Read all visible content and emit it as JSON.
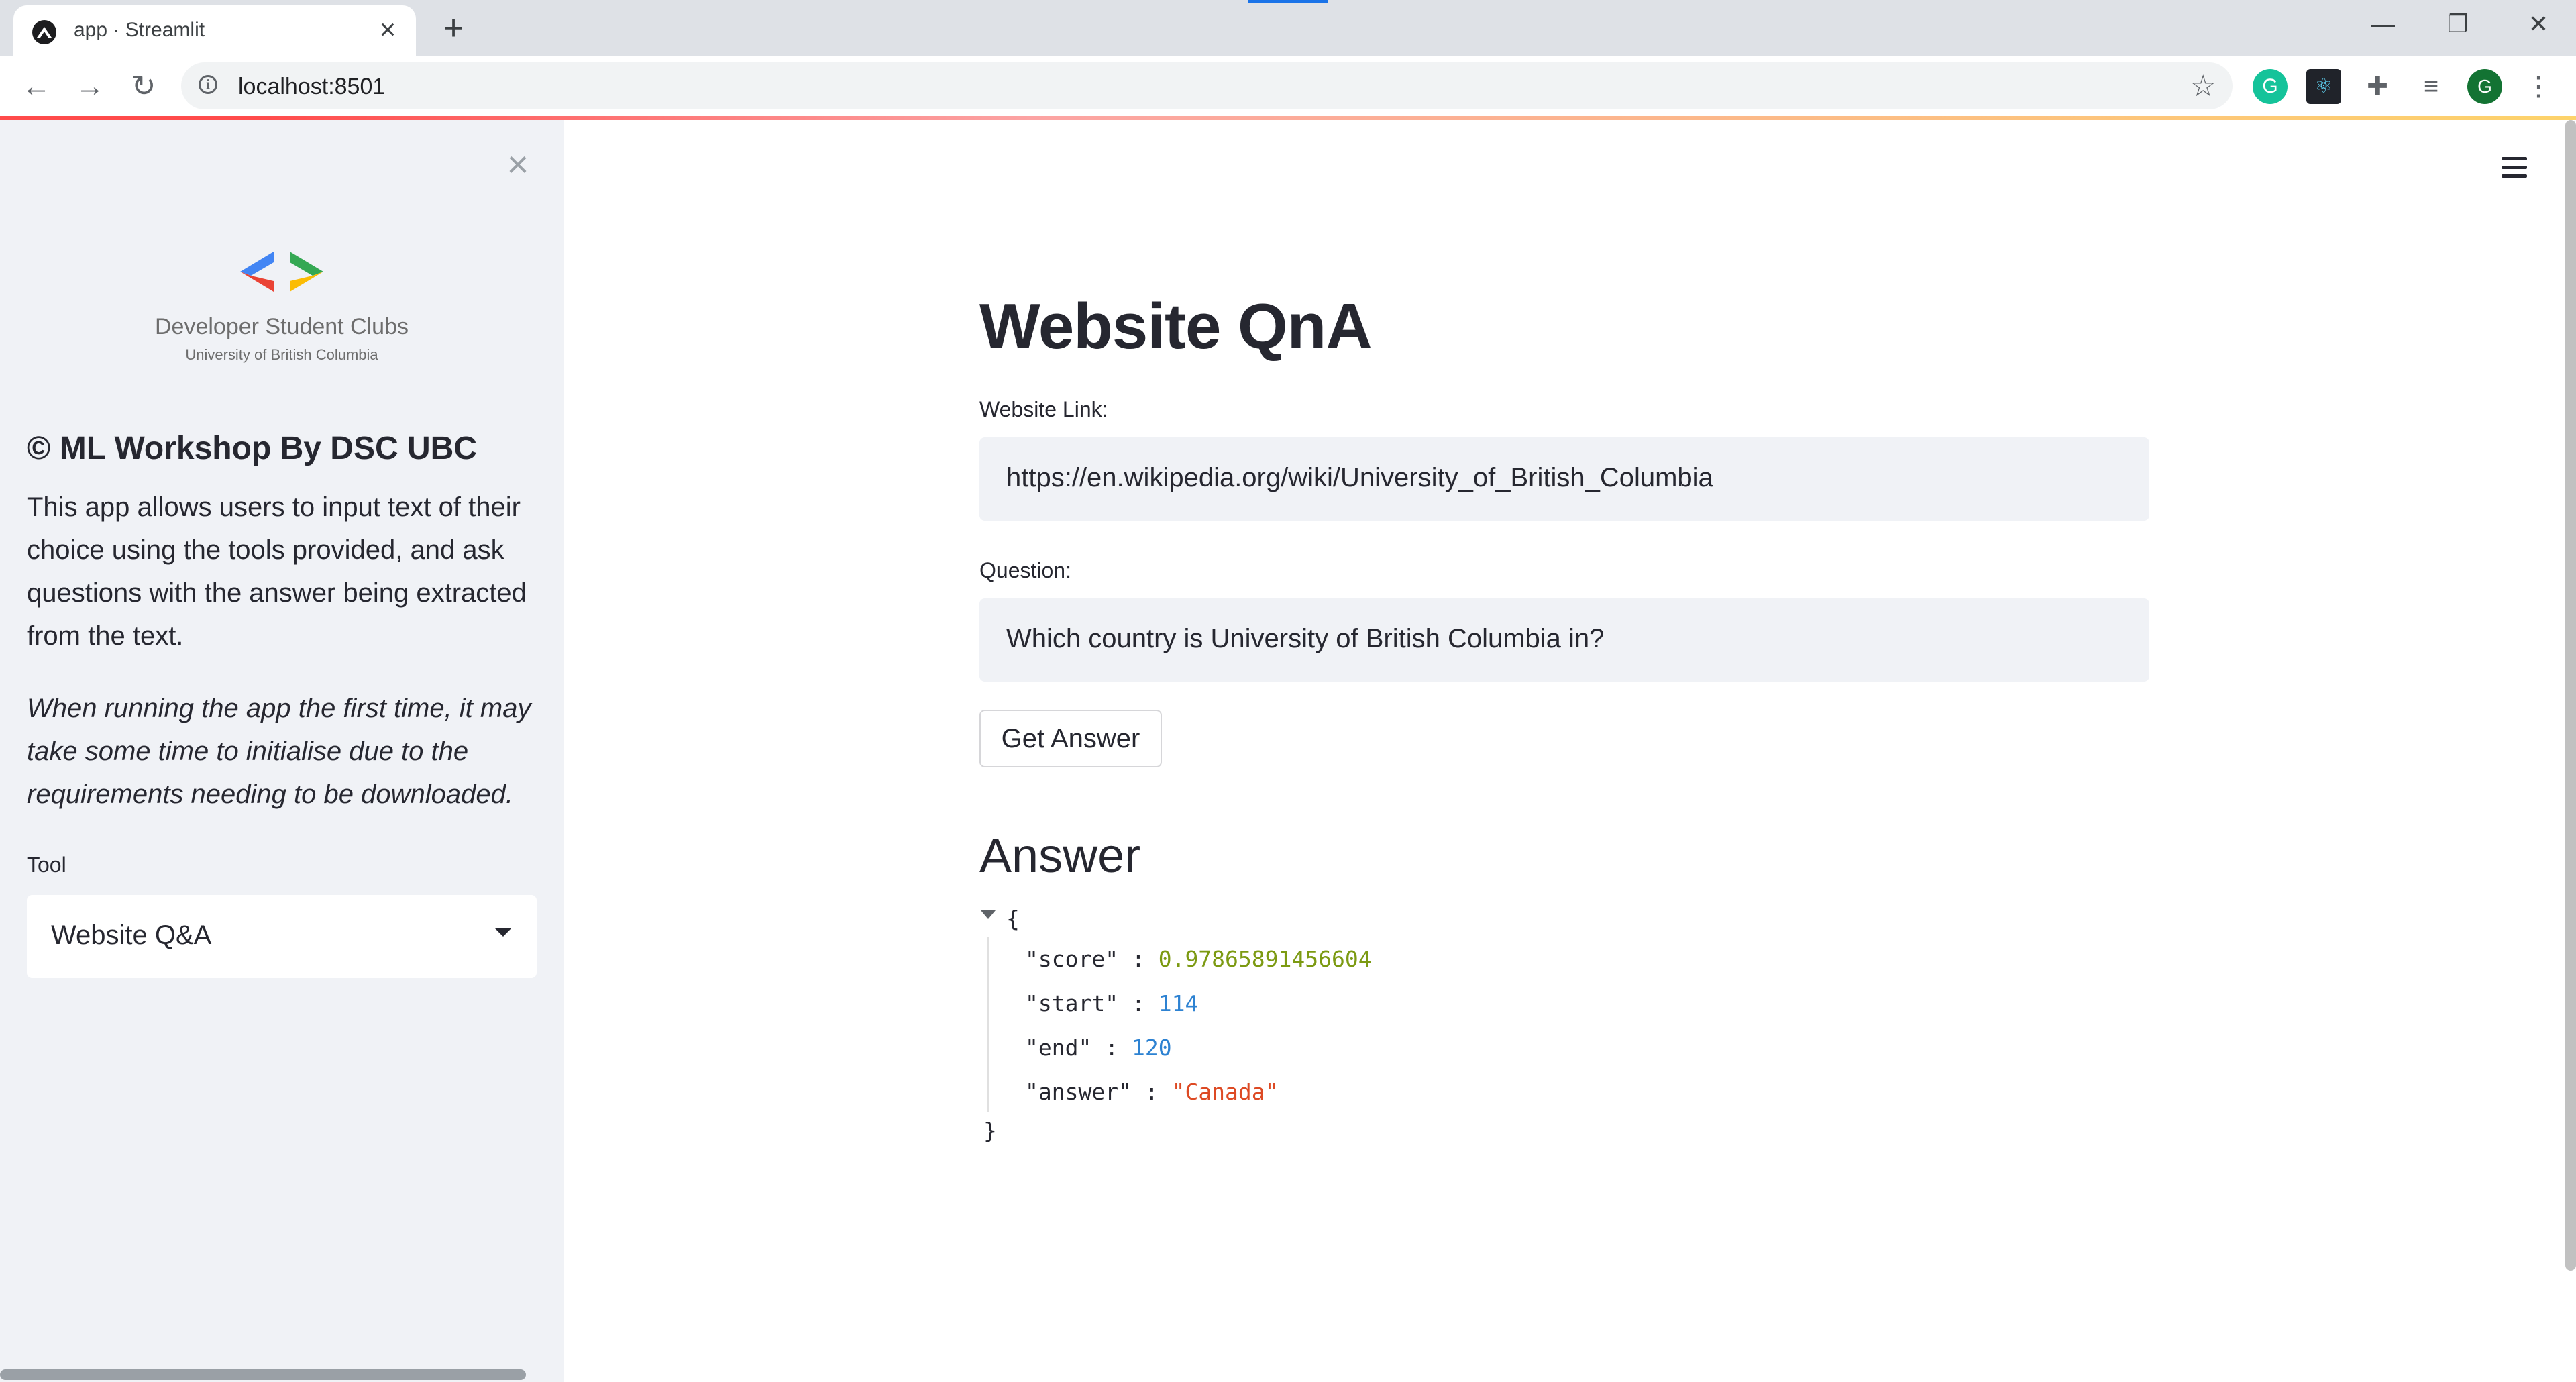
{
  "browser": {
    "tab_title": "app · Streamlit",
    "tab_close": "×",
    "new_tab": "+",
    "url": "localhost:8501",
    "profile_initial": "G",
    "window_controls": {
      "minimize": "—",
      "restore": "❐",
      "close": "✕"
    }
  },
  "sidebar": {
    "close_label": "×",
    "logo": {
      "title": "Developer Student Clubs",
      "subtitle": "University of British Columbia",
      "colors": [
        "#4285f4",
        "#ea4335",
        "#34a853",
        "#fbbc04"
      ]
    },
    "heading": "© ML Workshop By DSC UBC",
    "description": "This app allows users to input text of their choice using the tools provided, and ask questions with the answer being extracted from the text.",
    "note": "When running the app the first time, it may take some time to initialise due to the requirements needing to be downloaded.",
    "tool_label": "Tool",
    "tool_selected": "Website Q&A"
  },
  "main": {
    "title": "Website QnA",
    "website_label": "Website Link:",
    "website_value": "https://en.wikipedia.org/wiki/University_of_British_Columbia",
    "question_label": "Question:",
    "question_value": "Which country is University of British Columbia in?",
    "button_label": "Get Answer",
    "answer_heading": "Answer",
    "answer_json": {
      "open_brace": "{",
      "close_brace": "}",
      "score_key": "\"score\"",
      "score_value": "0.97865891456604",
      "start_key": "\"start\"",
      "start_value": "114",
      "end_key": "\"end\"",
      "end_value": "120",
      "answer_key": "\"answer\"",
      "answer_value": "\"Canada\"",
      "separator": ":"
    }
  },
  "theme": {
    "accent": "#ff4b4b",
    "sidebar_bg": "#f0f2f6",
    "text": "#262730"
  }
}
